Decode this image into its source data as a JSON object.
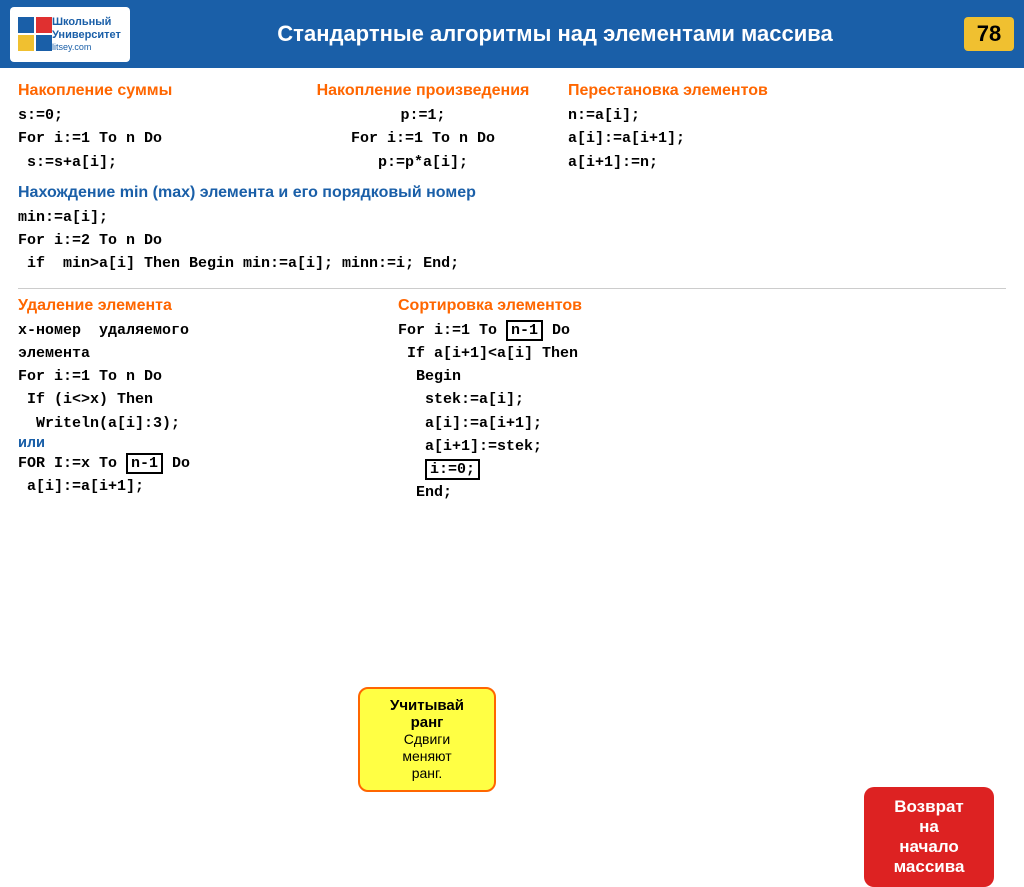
{
  "header": {
    "title": "Стандартные алгоритмы над элементами массива",
    "page_number": "78",
    "logo_line1": "Школьный",
    "logo_line2": "Университет",
    "logo_url": "litsey.com"
  },
  "sections": {
    "sum": {
      "title": "Накопление суммы",
      "code": [
        "s:=0;",
        "For i:=1 To n Do",
        " s:=s+a[i];"
      ]
    },
    "product": {
      "title": "Накопление произведения",
      "code": [
        "p:=1;",
        "For i:=1 To n Do",
        " p:=p*a[i];"
      ]
    },
    "swap": {
      "title": "Перестановка элементов",
      "code": [
        "n:=a[i];",
        "a[i]:=a[i+1];",
        "a[i+1]:=n;"
      ]
    },
    "min": {
      "title": "Нахождение  min (max) элемента и его порядковый номер",
      "code": [
        "min:=a[i];",
        "For i:=2 To n Do",
        " if  min>a[i] Then Begin min:=a[i]; minn:=i; End;"
      ]
    },
    "delete": {
      "title": "Удаление элемента",
      "code": [
        "x-номер  удаляемого",
        "элемента",
        "For i:=1 To n Do",
        " If (i<>x) Then",
        "  Writeln(a[i]:3);"
      ],
      "ili": "или",
      "code2": [
        "FOR I:=x To n-1 Do",
        " a[i]:=a[i+1];"
      ]
    },
    "sort": {
      "title": "Сортировка элементов",
      "code": [
        "For i:=1 To n-1 Do",
        " If a[i+1]<a[i] Then",
        "  Begin",
        "   stek:=a[i];",
        "   a[i]:=a[i+1];",
        "   a[i+1]:=stek;",
        "   i:=0;",
        "  End;"
      ]
    },
    "balloon_left": {
      "line1": "Учитывай",
      "line2": "ранг",
      "line3": "Сдвиги",
      "line4": "меняют",
      "line5": "ранг."
    },
    "balloon_right": {
      "line1": "Возврат",
      "line2": "на",
      "line3": "начало",
      "line4": "массива"
    }
  }
}
